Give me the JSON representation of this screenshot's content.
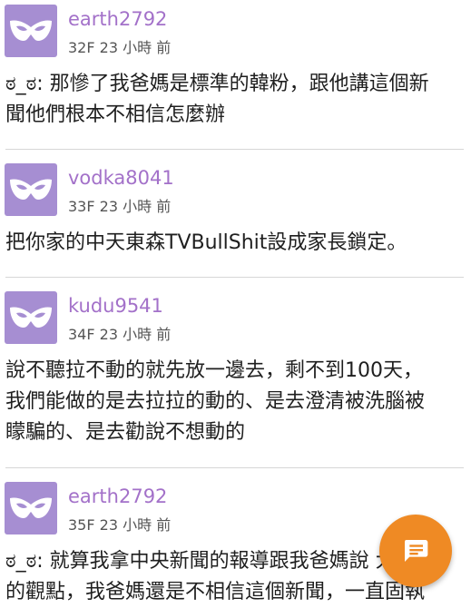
{
  "comments": [
    {
      "username": "earth2792",
      "floor": "32F",
      "time": "23 小時 前",
      "lines": [
        "ಠ_ಠ: 那慘了我爸媽是標準的韓粉，跟他講這個新",
        "聞他們根本不相信怎麼辦"
      ]
    },
    {
      "username": "vodka8041",
      "floor": "33F",
      "time": "23 小時 前",
      "lines": [
        "把你家的中天東森TVBullShit設成家長鎖定。"
      ]
    },
    {
      "username": "kudu9541",
      "floor": "34F",
      "time": "23 小時 前",
      "lines": [
        "說不聽拉不動的就先放一邊去，剩不到100天，",
        "我們能做的是去拉拉的動的、是去澄清被洗腦被",
        "矇騙的、是去勸說不想動的"
      ]
    },
    {
      "username": "earth2792",
      "floor": "35F",
      "time": "23 小時 前",
      "lines": [
        "ಠ_ಠ: 就算我拿中央新聞的報導跟我爸媽說   大",
        "的觀點，我爸媽還是不相信這個新聞，一直固執"
      ]
    }
  ],
  "avatar_icon": "mask-icon",
  "fab_icon": "comment-icon",
  "colors": {
    "avatar_bg": "#a68ed2",
    "username": "#a371c9",
    "fab": "#ef8a24"
  }
}
